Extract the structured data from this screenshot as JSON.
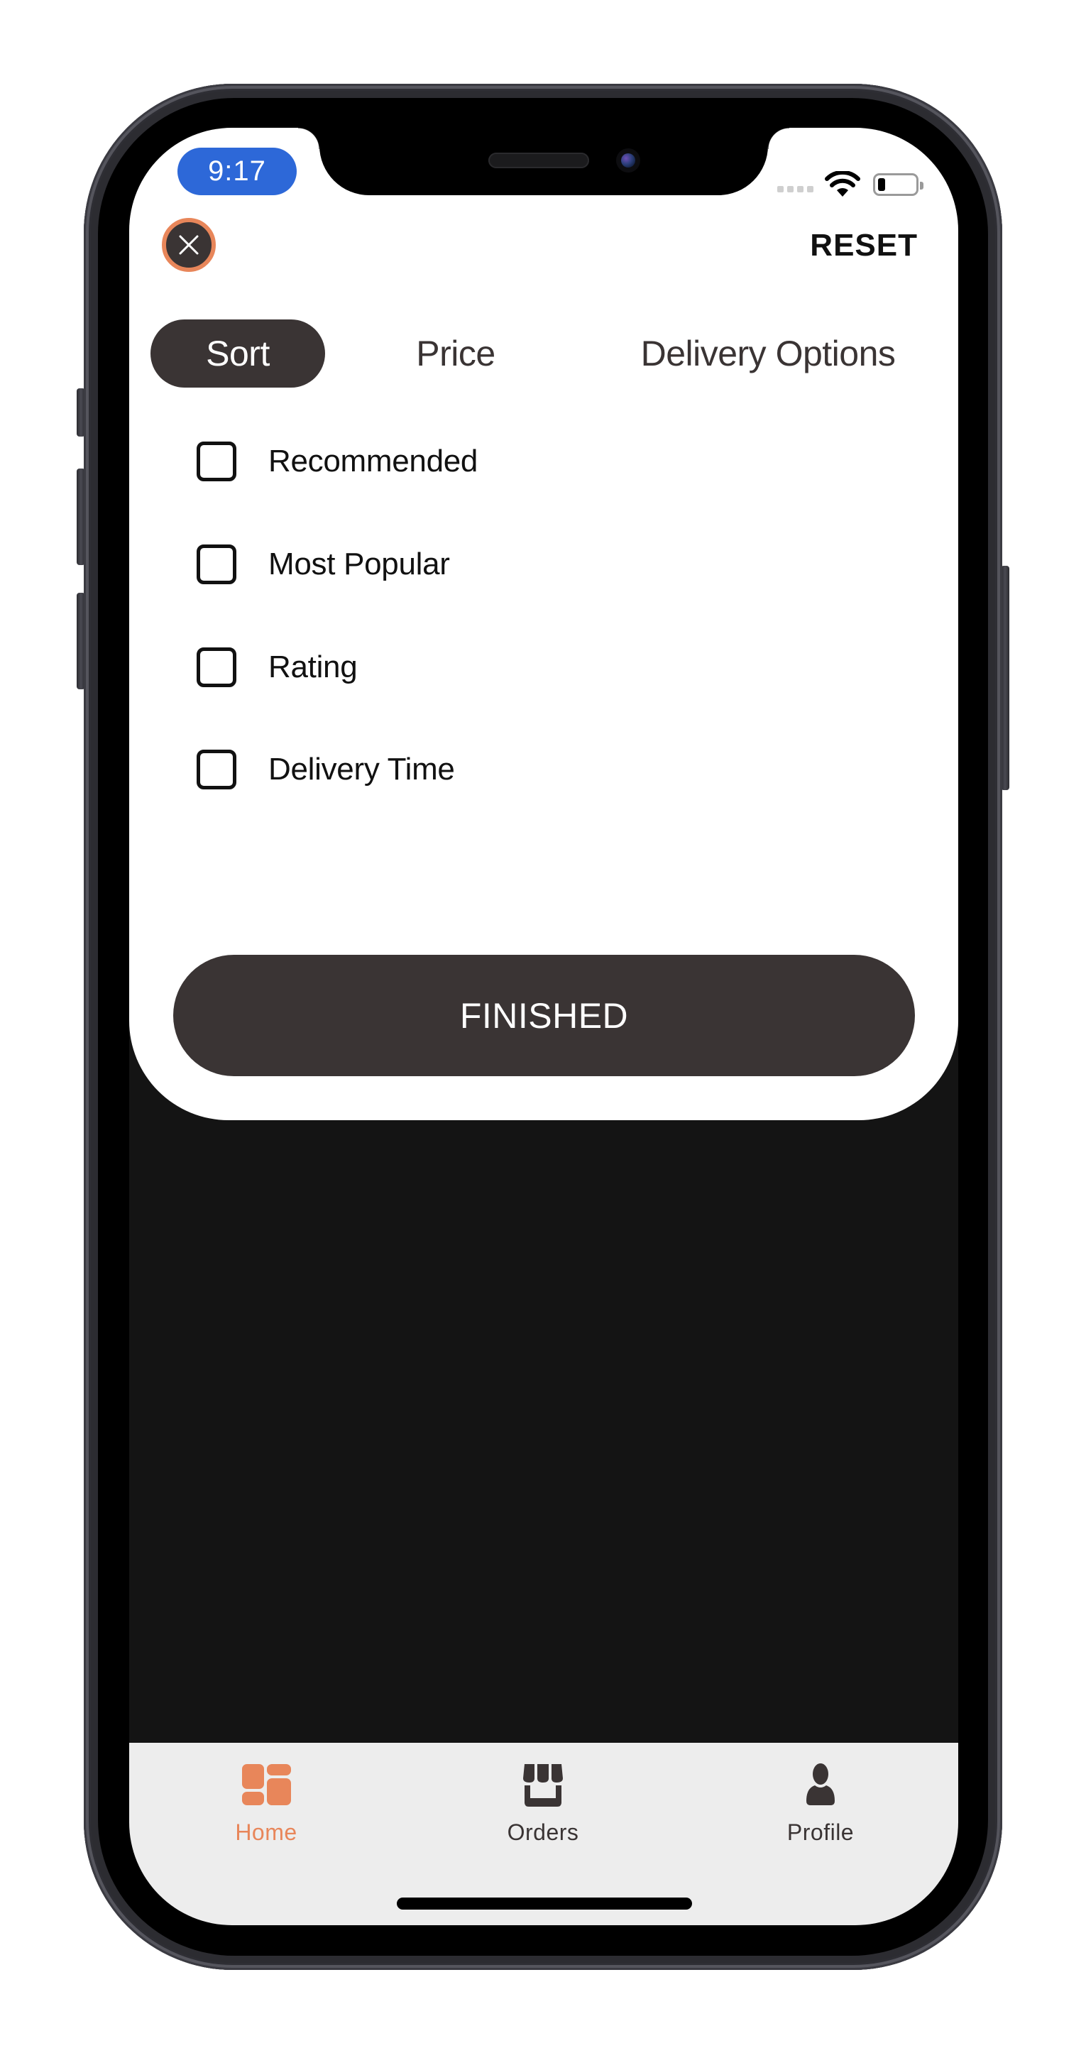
{
  "status_bar": {
    "time": "9:17",
    "signal_dots": 4,
    "wifi_icon": "wifi-icon",
    "battery_level_percent": 20
  },
  "header": {
    "close_icon": "close-icon",
    "reset_label": "RESET"
  },
  "tabs": [
    {
      "label": "Sort",
      "active": true
    },
    {
      "label": "Price",
      "active": false
    },
    {
      "label": "Delivery Options",
      "active": false
    }
  ],
  "sort_options": [
    {
      "label": "Recommended",
      "checked": false
    },
    {
      "label": "Most Popular",
      "checked": false
    },
    {
      "label": "Rating",
      "checked": false
    },
    {
      "label": "Delivery Time",
      "checked": false
    }
  ],
  "finished_label": "FINISHED",
  "bottom_nav": [
    {
      "label": "Home",
      "icon": "dashboard-icon",
      "active": true
    },
    {
      "label": "Orders",
      "icon": "store-icon",
      "active": false
    },
    {
      "label": "Profile",
      "icon": "person-icon",
      "active": false
    }
  ],
  "colors": {
    "accent": "#e8865a",
    "dark": "#3a3434",
    "time_pill": "#2d68d8",
    "background_dim": "#141414",
    "tabbar_bg": "#ededed"
  }
}
